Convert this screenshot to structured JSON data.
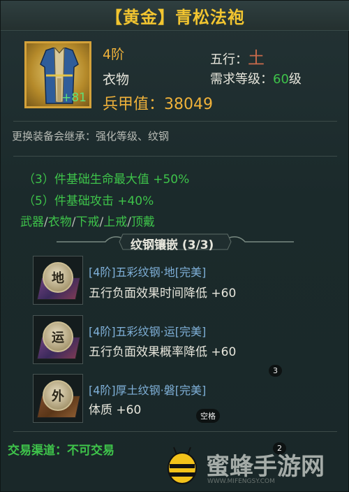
{
  "item": {
    "title": "【黄金】青松法袍",
    "tier": "4阶",
    "category": "衣物",
    "element_label": "五行：",
    "element_value": "土",
    "req_label": "需求等级：",
    "req_level": "60",
    "req_unit": "级",
    "enhance": "+81",
    "power_label": "兵甲值：",
    "power_value": "38049"
  },
  "inherit_note": "更换装备会继承：强化等级、纹钢",
  "set_bonus": [
    "（3）件基础生命最大值   +50%",
    "（5）件基础攻击   +40%"
  ],
  "set_parts": [
    "武器",
    "衣物",
    "下戒",
    "上戒",
    "顶戴"
  ],
  "sockets": {
    "header": "纹钢镶嵌 (3/3)",
    "items": [
      {
        "glyph": "地",
        "name": "[4阶]五彩纹钢·地[完美]",
        "effect": "五行负面效果时间降低    +60",
        "icon": "gem-earth-icon"
      },
      {
        "glyph": "运",
        "name": "[4阶]五彩纹钢·运[完美]",
        "effect": "五行负面效果概率降低    +60",
        "icon": "gem-luck-icon"
      },
      {
        "glyph": "外",
        "name": "[4阶]厚土纹钢·磐[完美]",
        "effect": "体质    +60",
        "icon": "gem-outer-icon"
      }
    ]
  },
  "trade": "交易渠道：不可交易",
  "badges": {
    "b1": "3",
    "b2": "空格",
    "b3": "2"
  },
  "watermark": {
    "text": "蜜蜂手游网",
    "url": "WWW.MIFENGSY.COM"
  },
  "colors": {
    "gold": "#f0b23a",
    "green": "#3ec34a",
    "title": "#f2c530"
  }
}
